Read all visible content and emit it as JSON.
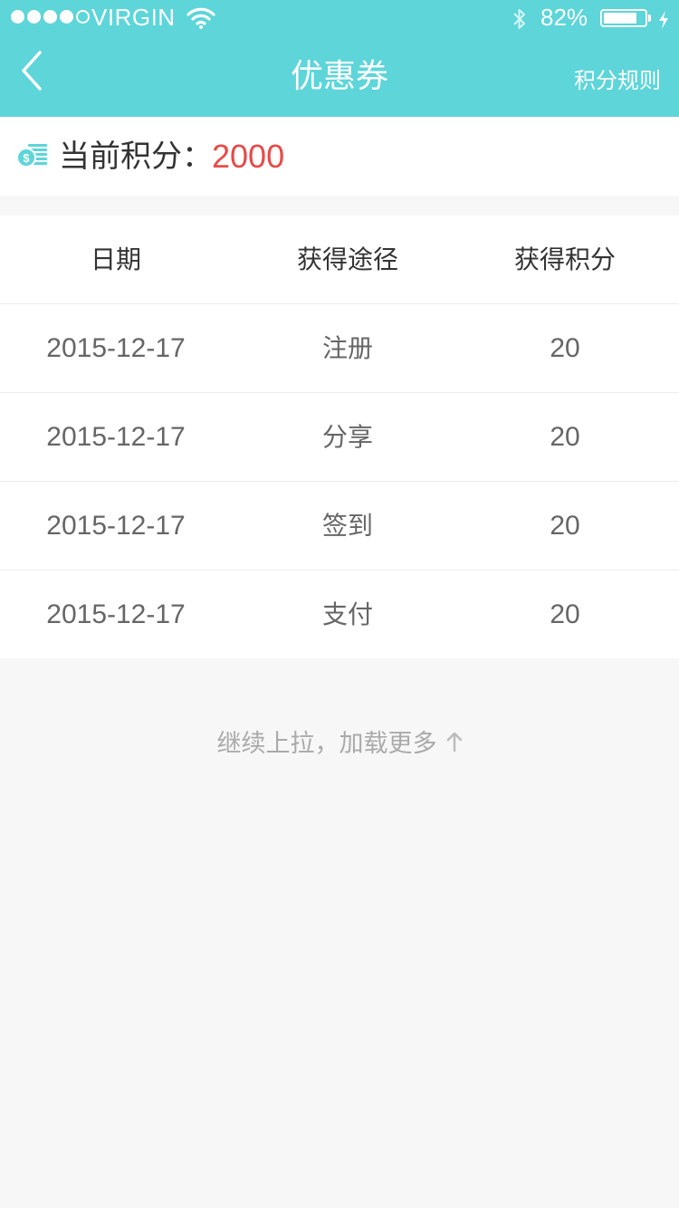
{
  "status_bar": {
    "carrier": "VIRGIN",
    "signal_filled": 4,
    "signal_total": 5,
    "battery_percent_text": "82%",
    "battery_level": 0.82
  },
  "nav": {
    "back_icon": "chevron-left-icon",
    "title": "优惠券",
    "right_action": "积分规则"
  },
  "points": {
    "icon": "coins-icon",
    "label": "当前积分：",
    "value": "2000"
  },
  "table": {
    "headers": [
      "日期",
      "获得途径",
      "获得积分"
    ],
    "rows": [
      {
        "date": "2015-12-17",
        "source": "注册",
        "points": "20"
      },
      {
        "date": "2015-12-17",
        "source": "分享",
        "points": "20"
      },
      {
        "date": "2015-12-17",
        "source": "签到",
        "points": "20"
      },
      {
        "date": "2015-12-17",
        "source": "支付",
        "points": "20"
      }
    ]
  },
  "load_more": {
    "text": "继续上拉，加载更多",
    "icon": "arrow-up-icon"
  },
  "colors": {
    "accent": "#5dd5d9",
    "points_value": "#e84a4a",
    "background": "#f7f7f7"
  }
}
